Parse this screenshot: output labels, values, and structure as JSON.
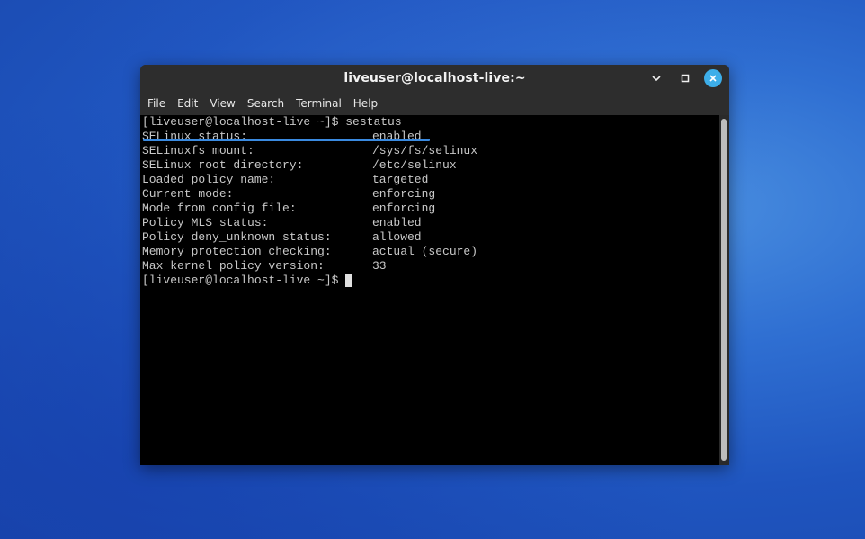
{
  "window": {
    "title": "liveuser@localhost-live:~"
  },
  "controls": {
    "minimize_icon": "chevron-down-icon",
    "maximize_icon": "square-icon",
    "close_icon": "close-icon",
    "close_color": "#3daee9"
  },
  "menu": [
    "File",
    "Edit",
    "View",
    "Search",
    "Terminal",
    "Help"
  ],
  "terminal": {
    "command_line": "[liveuser@localhost-live ~]$ sestatus",
    "rows": [
      {
        "label": "SELinux status:",
        "value": "enabled"
      },
      {
        "label": "SELinuxfs mount:",
        "value": "/sys/fs/selinux"
      },
      {
        "label": "SELinux root directory:",
        "value": "/etc/selinux"
      },
      {
        "label": "Loaded policy name:",
        "value": "targeted"
      },
      {
        "label": "Current mode:",
        "value": "enforcing"
      },
      {
        "label": "Mode from config file:",
        "value": "enforcing"
      },
      {
        "label": "Policy MLS status:",
        "value": "enabled"
      },
      {
        "label": "Policy deny_unknown status:",
        "value": "allowed"
      },
      {
        "label": "Memory protection checking:",
        "value": "actual (secure)"
      },
      {
        "label": "Max kernel policy version:",
        "value": "33"
      }
    ],
    "prompt": "[liveuser@localhost-live ~]$",
    "highlight_color": "#3a8ae0"
  }
}
